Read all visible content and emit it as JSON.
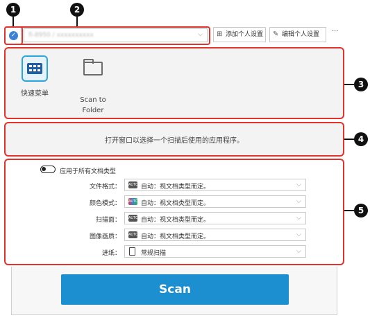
{
  "markers": [
    "1",
    "2",
    "3",
    "4",
    "5"
  ],
  "device": {
    "name": "fi-8950 / xxxxxxxxxx"
  },
  "toolbar": {
    "add_profile": "添加个人设置",
    "edit_profile": "编辑个人设置",
    "more": "···"
  },
  "apps": [
    {
      "label": "快速菜单",
      "icon": "quick-menu-grid-icon",
      "selected": true
    },
    {
      "label_line1": "Scan to",
      "label_line2": "Folder",
      "icon": "folder-icon",
      "selected": false
    }
  ],
  "app_hint": "打开窗口以选择一个扫描后使用的应用程序。",
  "settings": {
    "apply_all_label": "应用于所有文档类型",
    "rows": [
      {
        "label": "文件格式：",
        "icon": "auto-icon",
        "value": "自动：视文档类型而定。"
      },
      {
        "label": "颜色模式：",
        "icon": "auto-color-icon",
        "value": "自动：视文档类型而定。"
      },
      {
        "label": "扫描面：",
        "icon": "auto-side-icon",
        "value": "自动：视文档类型而定。"
      },
      {
        "label": "图像画质：",
        "icon": "auto-quality-icon",
        "value": "自动：视文档类型而定。"
      },
      {
        "label": "进纸：",
        "icon": "page-icon",
        "value": "常规扫描"
      }
    ]
  },
  "scan_button": "Scan",
  "colors": {
    "accent": "#1b8fd0",
    "highlight": "#e2322b",
    "selected_tile": "#2aa4dc"
  }
}
